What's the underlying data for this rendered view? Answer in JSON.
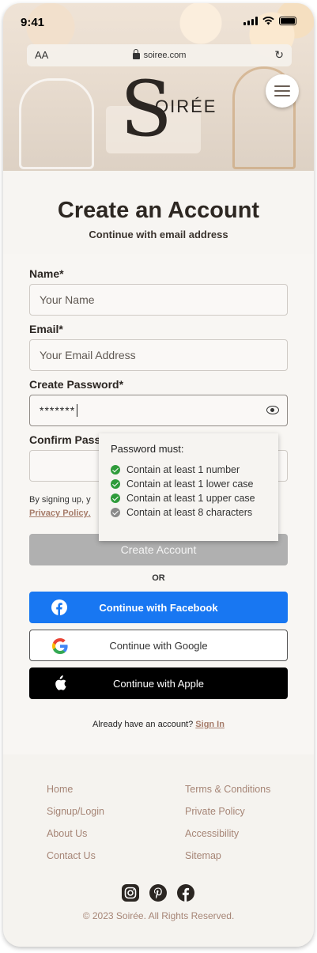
{
  "status_bar": {
    "time": "9:41"
  },
  "browser": {
    "text_size": "AA",
    "url": "soiree.com"
  },
  "brand": {
    "logo_letter": "S",
    "logo_rest": "OIRÉE"
  },
  "page": {
    "title": "Create an Account",
    "subtitle": "Continue with email address"
  },
  "form": {
    "name_label": "Name*",
    "name_placeholder": "Your Name",
    "email_label": "Email*",
    "email_placeholder": "Your Email Address",
    "password_label": "Create Password*",
    "password_value": "*******",
    "confirm_label": "Confirm Pass",
    "terms_text": "By signing up, y",
    "terms_link": "Privacy Policy",
    "terms_end": ".",
    "create_button": "Create Account",
    "or_divider": "OR"
  },
  "password_rules": {
    "title": "Password must:",
    "items": [
      {
        "text": "Contain at least 1 number",
        "met": true
      },
      {
        "text": "Contain at least 1 lower case",
        "met": true
      },
      {
        "text": "Contain at least 1 upper case",
        "met": true
      },
      {
        "text": "Contain at least 8 characters",
        "met": false
      }
    ]
  },
  "social": {
    "facebook": "Continue with Facebook",
    "google": "Continue with Google",
    "apple": "Continue with Apple"
  },
  "signin": {
    "prompt": "Already have an account? ",
    "link": "Sign In"
  },
  "footer": {
    "left_links": [
      "Home",
      "Signup/Login",
      "About Us",
      "Contact Us"
    ],
    "right_links": [
      "Terms & Conditions",
      "Private Policy",
      "Accessibility",
      "Sitemap"
    ],
    "copyright": "© 2023 Soirée. All Rights Reserved."
  },
  "colors": {
    "accent": "#a67c6a",
    "facebook": "#1877f2",
    "check_met": "#2e9b3a",
    "check_unmet": "#8a8a8a",
    "disabled_button": "#b0b0b0"
  }
}
